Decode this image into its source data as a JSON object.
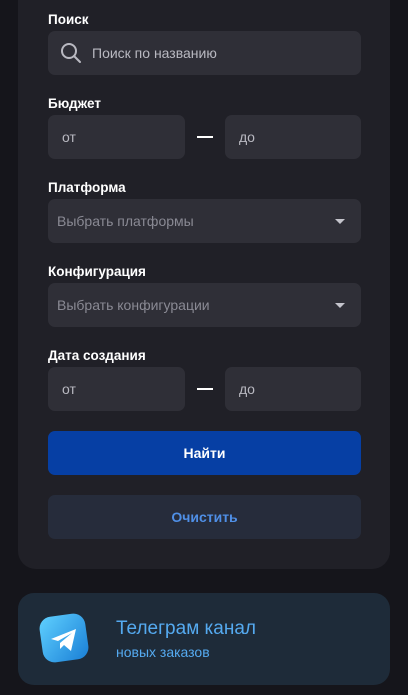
{
  "filters": {
    "search": {
      "label": "Поиск",
      "placeholder": "Поиск по названию"
    },
    "budget": {
      "label": "Бюджет",
      "from_placeholder": "от",
      "to_placeholder": "до"
    },
    "platform": {
      "label": "Платформа",
      "placeholder": "Выбрать платформы"
    },
    "configuration": {
      "label": "Конфигурация",
      "placeholder": "Выбрать конфигурации"
    },
    "created": {
      "label": "Дата создания",
      "from_placeholder": "от",
      "to_placeholder": "до"
    }
  },
  "buttons": {
    "find": "Найти",
    "clear": "Очистить"
  },
  "telegram": {
    "title": "Телеграм канал",
    "subtitle": "новых заказов",
    "icon": "telegram-icon"
  },
  "colors": {
    "primary": "#063fa4",
    "accent": "#4f8fe6",
    "telegram": "#55aaf0"
  }
}
